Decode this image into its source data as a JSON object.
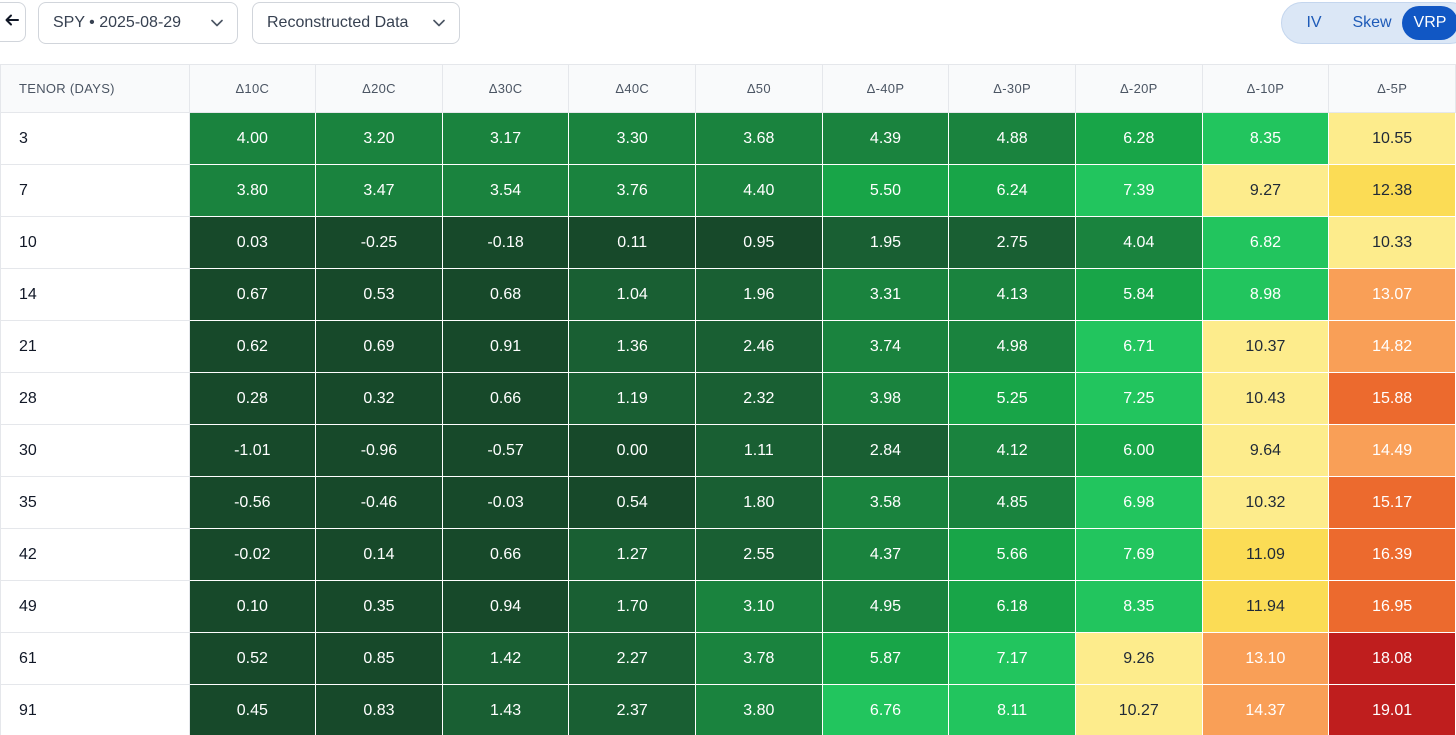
{
  "toolbar": {
    "back_icon": "arrow-left-icon",
    "symbol_select": "SPY • 2025-08-29",
    "source_select": "Reconstructed Data",
    "view_tabs": [
      {
        "label": "IV",
        "active": false
      },
      {
        "label": "Skew",
        "active": false
      },
      {
        "label": "VRP",
        "active": true
      }
    ],
    "accent_color": "#1157c4"
  },
  "table": {
    "tenor_header": "TENOR (DAYS)",
    "columns": [
      "Δ10C",
      "Δ20C",
      "Δ30C",
      "Δ40C",
      "Δ50",
      "Δ-40P",
      "Δ-30P",
      "Δ-20P",
      "Δ-10P",
      "Δ-5P"
    ],
    "rows": [
      {
        "tenor": "3",
        "values": [
          "4.00",
          "3.20",
          "3.17",
          "3.30",
          "3.68",
          "4.39",
          "4.88",
          "6.28",
          "8.35",
          "10.55"
        ]
      },
      {
        "tenor": "7",
        "values": [
          "3.80",
          "3.47",
          "3.54",
          "3.76",
          "4.40",
          "5.50",
          "6.24",
          "7.39",
          "9.27",
          "12.38"
        ]
      },
      {
        "tenor": "10",
        "values": [
          "0.03",
          "-0.25",
          "-0.18",
          "0.11",
          "0.95",
          "1.95",
          "2.75",
          "4.04",
          "6.82",
          "10.33"
        ]
      },
      {
        "tenor": "14",
        "values": [
          "0.67",
          "0.53",
          "0.68",
          "1.04",
          "1.96",
          "3.31",
          "4.13",
          "5.84",
          "8.98",
          "13.07"
        ]
      },
      {
        "tenor": "21",
        "values": [
          "0.62",
          "0.69",
          "0.91",
          "1.36",
          "2.46",
          "3.74",
          "4.98",
          "6.71",
          "10.37",
          "14.82"
        ]
      },
      {
        "tenor": "28",
        "values": [
          "0.28",
          "0.32",
          "0.66",
          "1.19",
          "2.32",
          "3.98",
          "5.25",
          "7.25",
          "10.43",
          "15.88"
        ]
      },
      {
        "tenor": "30",
        "values": [
          "-1.01",
          "-0.96",
          "-0.57",
          "0.00",
          "1.11",
          "2.84",
          "4.12",
          "6.00",
          "9.64",
          "14.49"
        ]
      },
      {
        "tenor": "35",
        "values": [
          "-0.56",
          "-0.46",
          "-0.03",
          "0.54",
          "1.80",
          "3.58",
          "4.85",
          "6.98",
          "10.32",
          "15.17"
        ]
      },
      {
        "tenor": "42",
        "values": [
          "-0.02",
          "0.14",
          "0.66",
          "1.27",
          "2.55",
          "4.37",
          "5.66",
          "7.69",
          "11.09",
          "16.39"
        ]
      },
      {
        "tenor": "49",
        "values": [
          "0.10",
          "0.35",
          "0.94",
          "1.70",
          "3.10",
          "4.95",
          "6.18",
          "8.35",
          "11.94",
          "16.95"
        ]
      },
      {
        "tenor": "61",
        "values": [
          "0.52",
          "0.85",
          "1.42",
          "2.27",
          "3.78",
          "5.87",
          "7.17",
          "9.26",
          "13.10",
          "18.08"
        ]
      },
      {
        "tenor": "91",
        "values": [
          "0.45",
          "0.83",
          "1.43",
          "2.37",
          "3.80",
          "6.76",
          "8.11",
          "10.27",
          "14.37",
          "19.01"
        ]
      }
    ],
    "color_scale": [
      {
        "max": 1.0,
        "bg": "#17492a",
        "fg": "#ffffff"
      },
      {
        "max": 3.0,
        "bg": "#195f33",
        "fg": "#ffffff"
      },
      {
        "max": 5.0,
        "bg": "#1a833e",
        "fg": "#ffffff"
      },
      {
        "max": 6.5,
        "bg": "#18a548",
        "fg": "#ffffff"
      },
      {
        "max": 9.0,
        "bg": "#22c55e",
        "fg": "#ffffff"
      },
      {
        "max": 11.0,
        "bg": "#fdec8c",
        "fg": "#1f2937"
      },
      {
        "max": 12.5,
        "bg": "#fbdc55",
        "fg": "#1f2937"
      },
      {
        "max": 15.0,
        "bg": "#f99f57",
        "fg": "#ffffff"
      },
      {
        "max": 17.5,
        "bg": "#ec6a2e",
        "fg": "#ffffff"
      },
      {
        "max": 100,
        "bg": "#bf1e1e",
        "fg": "#ffffff"
      }
    ]
  }
}
